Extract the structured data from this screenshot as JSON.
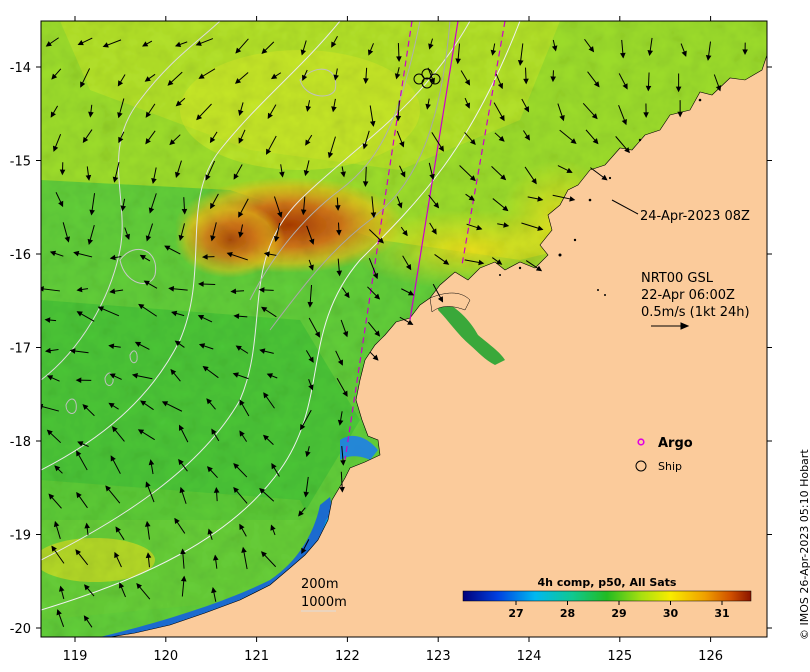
{
  "map": {
    "x_ticks": [
      "119",
      "120",
      "121",
      "122",
      "123",
      "124",
      "125",
      "126"
    ],
    "y_ticks": [
      "-14",
      "-15",
      "-16",
      "-17",
      "-18",
      "-19",
      "-20"
    ],
    "timestamp_label": "24-Apr-2023 08Z",
    "currents": {
      "product": "NRT00 GSL",
      "time": "22-Apr 06:00Z",
      "scale": "0.5m/s (1kt 24h)"
    },
    "legend": {
      "argo": "Argo",
      "ship": "Ship",
      "argo_color": "#e000e0"
    },
    "colorbar": {
      "title": "4h comp, p50, All Sats",
      "ticks": [
        "27",
        "28",
        "29",
        "30",
        "31"
      ]
    },
    "isobaths": {
      "shallow": "200m",
      "deep": "1000m"
    },
    "credit": "© IMOS 26-Apr-2023 05:10 Hobart",
    "colors": {
      "land": "#fbcb9b",
      "cold": "#0000a0",
      "mid": "#22bb22",
      "warm": "#ffee00",
      "hot": "#9a2a00"
    }
  }
}
